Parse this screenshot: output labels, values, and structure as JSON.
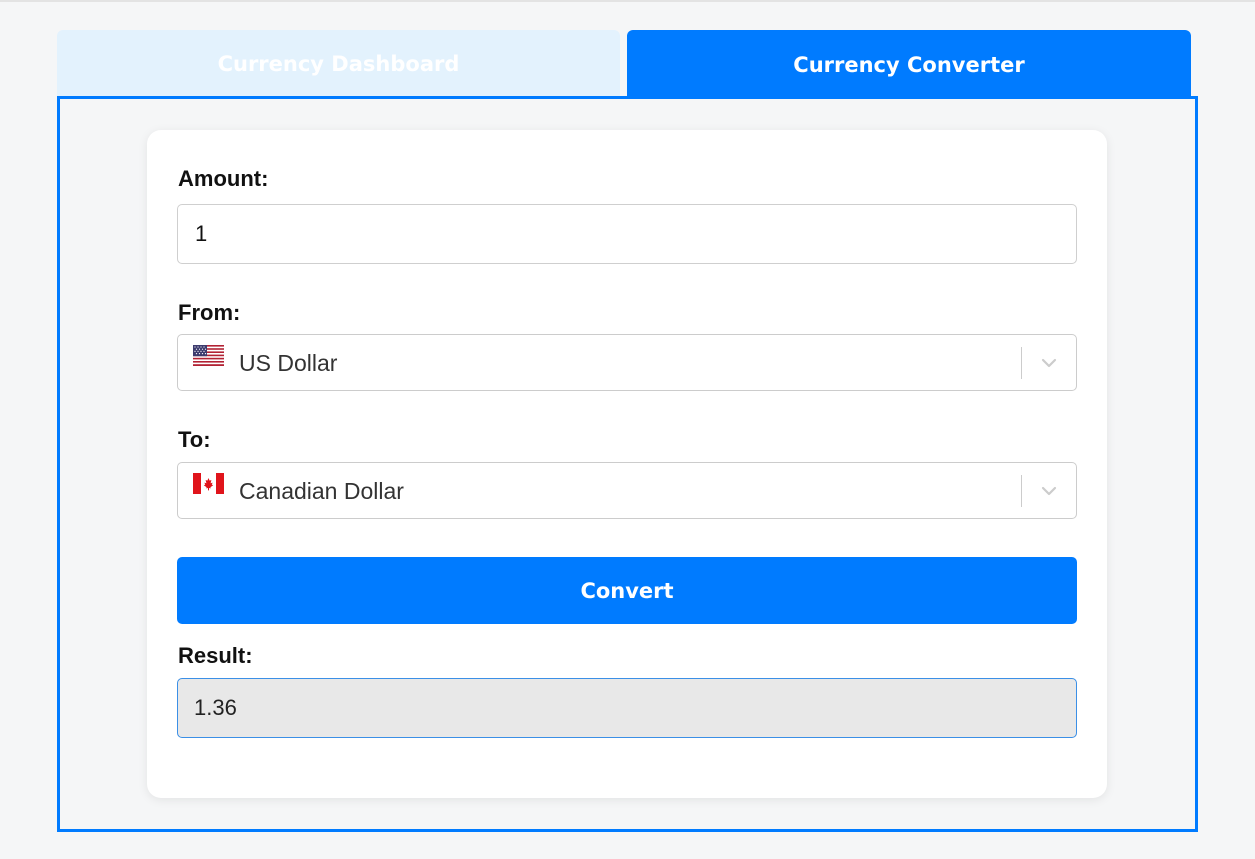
{
  "tabs": [
    {
      "label": "Currency Dashboard",
      "active": false
    },
    {
      "label": "Currency Converter",
      "active": true
    }
  ],
  "converter": {
    "amount_label": "Amount:",
    "amount_value": "1",
    "from_label": "From:",
    "from_currency": {
      "name": "US Dollar",
      "flag": "us-flag-icon"
    },
    "to_label": "To:",
    "to_currency": {
      "name": "Canadian Dollar",
      "flag": "canada-flag-icon"
    },
    "convert_label": "Convert",
    "result_label": "Result:",
    "result_value": "1.36"
  },
  "colors": {
    "accent": "#007bff",
    "inactive_tab": "#e3f2fd",
    "result_bg": "#e8e8e8"
  }
}
